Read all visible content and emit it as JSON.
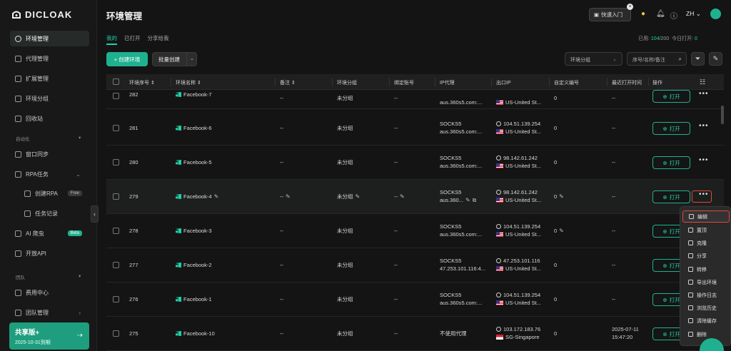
{
  "app": {
    "logo_text": "DICLOAK"
  },
  "sidebar": {
    "items": [
      {
        "label": "环境管理",
        "icon": "environment-icon"
      },
      {
        "label": "代理管理",
        "icon": "proxy-icon"
      },
      {
        "label": "扩展管理",
        "icon": "extension-icon"
      },
      {
        "label": "环境分组",
        "icon": "group-icon"
      },
      {
        "label": "回收站",
        "icon": "trash-icon"
      }
    ],
    "automation_label": "自动化",
    "automation_items": [
      {
        "label": "窗口同步",
        "icon": "sync-icon"
      },
      {
        "label": "RPA任务",
        "icon": "rpa-icon"
      },
      {
        "label": "创建RPA",
        "icon": "rpa-create-icon",
        "tag": "Free"
      },
      {
        "label": "任务记录",
        "icon": "task-log-icon"
      },
      {
        "label": "AI 爬虫",
        "icon": "ai-crawler-icon",
        "tag": "Beta"
      },
      {
        "label": "开放API",
        "icon": "api-icon"
      }
    ],
    "team_label": "团队",
    "team_items": [
      {
        "label": "费用中心",
        "icon": "billing-icon"
      },
      {
        "label": "团队管理",
        "icon": "team-icon"
      }
    ],
    "plan": {
      "title": "共享版+",
      "expiry": "2025-10-31到期"
    }
  },
  "header": {
    "title": "环境管理",
    "quick_start": "快速入门",
    "language": "ZH"
  },
  "tabs": [
    "我的",
    "已打开",
    "分享给我"
  ],
  "usage": {
    "prefix": "已用:",
    "used": "104",
    "total": "/200",
    "today_prefix": "今日打开:",
    "today": "0"
  },
  "toolbar": {
    "create_label": "+ 创建环境",
    "batch_label": "批量创建",
    "group_select": "环境分组",
    "search_placeholder": "序号/名称/备注"
  },
  "table": {
    "columns": [
      "环境序号",
      "环境名称",
      "备注",
      "环境分组",
      "绑定账号",
      "IP代理",
      "出口IP",
      "自定义编号",
      "最近打开时间",
      "操作"
    ],
    "open_label": "打开",
    "rows": [
      {
        "seq": "282",
        "name": "Facebook-7",
        "note": "--",
        "group": "未分组",
        "account": "--",
        "proxy1": "SOCKS5",
        "proxy2": "aus.360s5.com:...",
        "ip": "",
        "country": "US-United St...",
        "flag": "us",
        "custom": "0",
        "last": "--"
      },
      {
        "seq": "281",
        "name": "Facebook-6",
        "note": "--",
        "group": "未分组",
        "account": "--",
        "proxy1": "SOCKS5",
        "proxy2": "aus.360s5.com:...",
        "ip": "104.51.139.254",
        "country": "US-United St...",
        "flag": "us",
        "custom": "0",
        "last": "--"
      },
      {
        "seq": "280",
        "name": "Facebook-5",
        "note": "--",
        "group": "未分组",
        "account": "--",
        "proxy1": "SOCKS5",
        "proxy2": "aus.360s5.com:...",
        "ip": "98.142.61.242",
        "country": "US-United St...",
        "flag": "us",
        "custom": "0",
        "last": "--"
      },
      {
        "seq": "279",
        "name": "Facebook-4",
        "note": "--",
        "group": "未分组",
        "account": "--",
        "proxy1": "SOCKS5",
        "proxy2": "aus.360...",
        "ip": "98.142.61.242",
        "country": "US-United St...",
        "flag": "us",
        "custom": "0",
        "last": "--"
      },
      {
        "seq": "278",
        "name": "Facebook-3",
        "note": "--",
        "group": "未分组",
        "account": "--",
        "proxy1": "SOCKS5",
        "proxy2": "aus.360s5.com:...",
        "ip": "104.51.139.254",
        "country": "US-United St...",
        "flag": "us",
        "custom": "0",
        "last": "--"
      },
      {
        "seq": "277",
        "name": "Facebook-2",
        "note": "--",
        "group": "未分组",
        "account": "--",
        "proxy1": "SOCKS5",
        "proxy2": "47.253.101.116:4...",
        "ip": "47.253.101.116",
        "country": "US-United St...",
        "flag": "us",
        "custom": "0",
        "last": "--"
      },
      {
        "seq": "276",
        "name": "Facebook-1",
        "note": "--",
        "group": "未分组",
        "account": "--",
        "proxy1": "SOCKS5",
        "proxy2": "aus.360s5.com:...",
        "ip": "104.51.139.254",
        "country": "US-United St...",
        "flag": "us",
        "custom": "0",
        "last": "--"
      },
      {
        "seq": "275",
        "name": "Facebook-10",
        "note": "--",
        "group": "未分组",
        "account": "--",
        "proxy1": "不使用代理",
        "proxy2": "",
        "ip": "103.172.183.76",
        "country": "SG-Singapore",
        "flag": "sg",
        "custom": "0",
        "last": "2025-07-11",
        "last2": "15:47:20"
      }
    ]
  },
  "context_menu": [
    {
      "label": "编辑",
      "icon": "edit-icon"
    },
    {
      "label": "置顶",
      "icon": "pin-icon"
    },
    {
      "label": "克隆",
      "icon": "clone-icon"
    },
    {
      "label": "分享",
      "icon": "share-icon"
    },
    {
      "label": "转移",
      "icon": "transfer-icon"
    },
    {
      "label": "导出环境",
      "icon": "export-icon"
    },
    {
      "label": "操作日志",
      "icon": "log-icon"
    },
    {
      "label": "浏览历史",
      "icon": "history-icon"
    },
    {
      "label": "清除缓存",
      "icon": "clear-cache-icon"
    },
    {
      "label": "删除",
      "icon": "delete-icon"
    }
  ],
  "colors": {
    "accent": "#1fb18f",
    "highlight": "#e04a3a",
    "background": "#141414"
  }
}
